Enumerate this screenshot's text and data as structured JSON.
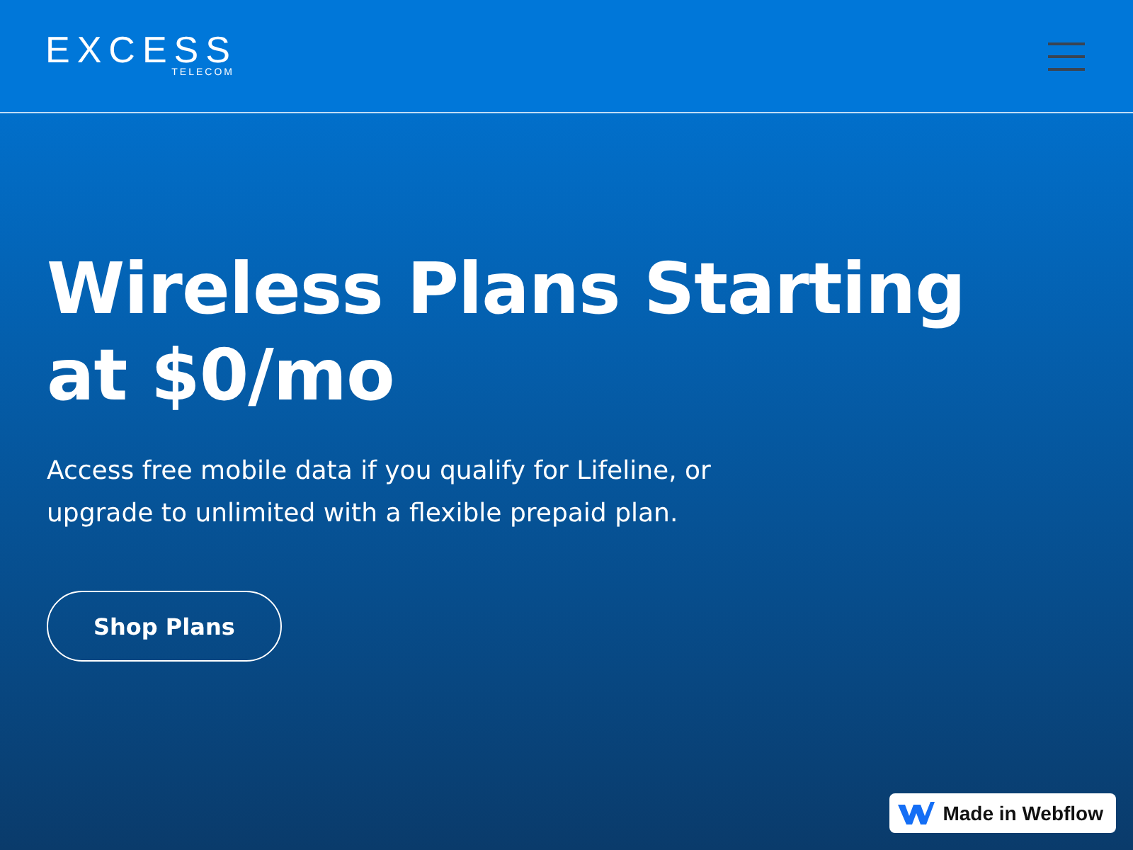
{
  "header": {
    "logo": {
      "name": "EXCESS",
      "tagline": "TELECOM"
    },
    "menu_open": false
  },
  "hero": {
    "title": "Wireless Plans Starting at $0/mo",
    "subtitle": "Access free mobile data if you qualify for Lifeline, or upgrade to unlimited with a flexible prepaid plan.",
    "button": "Shop Plans"
  },
  "badge": {
    "label": "Made in Webflow"
  }
}
